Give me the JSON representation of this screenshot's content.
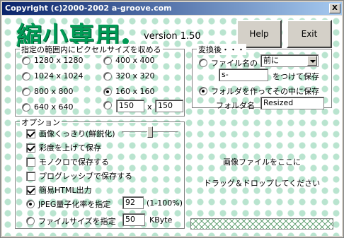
{
  "window": {
    "title": "Copyright (c)2000-2002 a-groove.com",
    "close_glyph": "X"
  },
  "logo": {
    "text": "縮小専用",
    "version": "version 1.50"
  },
  "buttons": {
    "help": "Help",
    "exit": "Exit"
  },
  "size_group": {
    "legend": "指定の範囲内にピクセルサイズを収める",
    "options": [
      {
        "label": "1280 x 1280",
        "selected": false
      },
      {
        "label": "400 x 400",
        "selected": false
      },
      {
        "label": "1024 x 1024",
        "selected": false
      },
      {
        "label": "320 x 320",
        "selected": false
      },
      {
        "label": "800 x 800",
        "selected": false
      },
      {
        "label": "160 x 160",
        "selected": true
      },
      {
        "label": "640 x 640",
        "selected": false
      }
    ],
    "custom": {
      "width": "150",
      "separator": "x",
      "height": "150"
    }
  },
  "convert_group": {
    "legend": "変換後・・・",
    "filename_option": "ファイル名の",
    "position_select": "前に",
    "prefix_value": "s-",
    "suffix_label": "をつけて保存",
    "folder_option": "フォルダを作ってその中に保存",
    "folder_label": "フォルダ名",
    "folder_value": "Resized"
  },
  "options_group": {
    "legend": "オプション",
    "sharpen": "画像くっきり(鮮鋭化)",
    "saturation": "彩度を上げて保存",
    "monochrome": "モノクロで保存する",
    "progressive": "プログレッシブで保存する",
    "html_output": "簡易HTML出力",
    "jpeg_quality_label": "JPEG量子化率を指定",
    "jpeg_quality_value": "92",
    "jpeg_quality_range": "(1-100%)",
    "filesize_label": "ファイルサイズを指定",
    "filesize_value": "50",
    "filesize_unit": "KByte",
    "sharpen_level": 0.5
  },
  "drop_zone": {
    "line1": "画像ファイルをここに",
    "line2": "ドラッグ＆ドロップしてください"
  }
}
